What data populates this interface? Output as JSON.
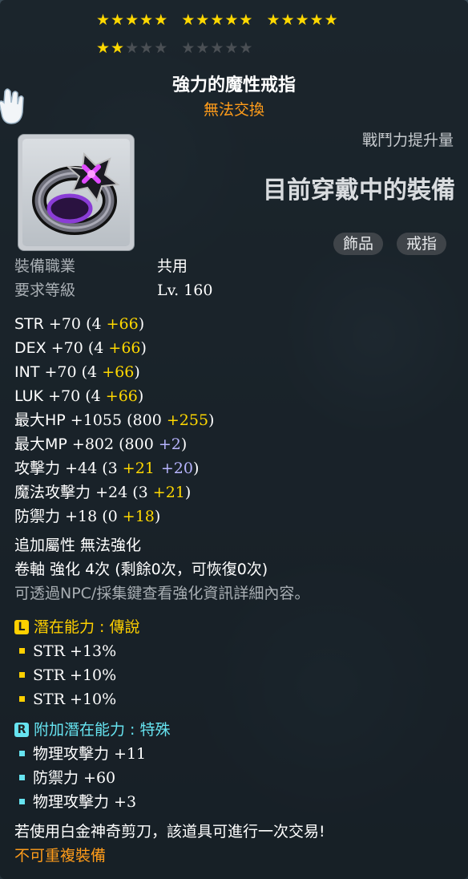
{
  "stars": {
    "filled": 17,
    "total": 25
  },
  "item": {
    "name": "強力的魔性戒指",
    "trade_status": "無法交換",
    "power_label": "戰鬥力提升量",
    "equipped_label": "目前穿戴中的裝備",
    "tags": [
      "飾品",
      "戒指"
    ],
    "icon": "purple-ring-icon"
  },
  "requirements": [
    {
      "label": "裝備職業",
      "value": "共用"
    },
    {
      "label": "要求等級",
      "value": "Lv. 160"
    }
  ],
  "stats": [
    {
      "name": "STR",
      "total": "+70",
      "base": "(4",
      "bonus": "+66",
      "extra": "",
      "close": ")"
    },
    {
      "name": "DEX",
      "total": "+70",
      "base": "(4",
      "bonus": "+66",
      "extra": "",
      "close": ")"
    },
    {
      "name": "INT",
      "total": "+70",
      "base": "(4",
      "bonus": "+66",
      "extra": "",
      "close": ")"
    },
    {
      "name": "LUK",
      "total": "+70",
      "base": "(4",
      "bonus": "+66",
      "extra": "",
      "close": ")"
    },
    {
      "name": "最大HP",
      "total": "+1055",
      "base": "(800",
      "bonus": "+255",
      "extra": "",
      "close": ")"
    },
    {
      "name": "最大MP",
      "total": "+802",
      "base": "(800",
      "bonus": "",
      "extra": "+2",
      "close": ")"
    },
    {
      "name": "攻擊力",
      "total": "+44",
      "base": "(3",
      "bonus": "+21",
      "extra": "+20",
      "close": ")"
    },
    {
      "name": "魔法攻擊力",
      "total": "+24",
      "base": "(3",
      "bonus": "+21",
      "extra": "",
      "close": ")"
    },
    {
      "name": "防禦力",
      "total": "+18",
      "base": "(0",
      "bonus": "+18",
      "extra": "",
      "close": ")"
    }
  ],
  "info": {
    "extra_attr": "追加屬性 無法強化",
    "scroll": "卷軸 強化 4次 (剩餘0次，可恢復0次)",
    "hint": "可透過NPC/採集鍵查看強化資訊詳細內容。"
  },
  "potential": {
    "badge": "L",
    "title": "潛在能力 : 傳說",
    "color": "#ffd000",
    "lines": [
      "STR +13%",
      "STR +10%",
      "STR +10%"
    ]
  },
  "bonus_potential": {
    "badge": "R",
    "title": "附加潛在能力 : 特殊",
    "color": "#66e3f0",
    "lines": [
      "物理攻擊力 +11",
      "防禦力 +60",
      "物理攻擊力 +3"
    ]
  },
  "footer": {
    "scissors": "若使用白金神奇剪刀，該道具可進行一次交易!",
    "unique": "不可重複裝備"
  }
}
